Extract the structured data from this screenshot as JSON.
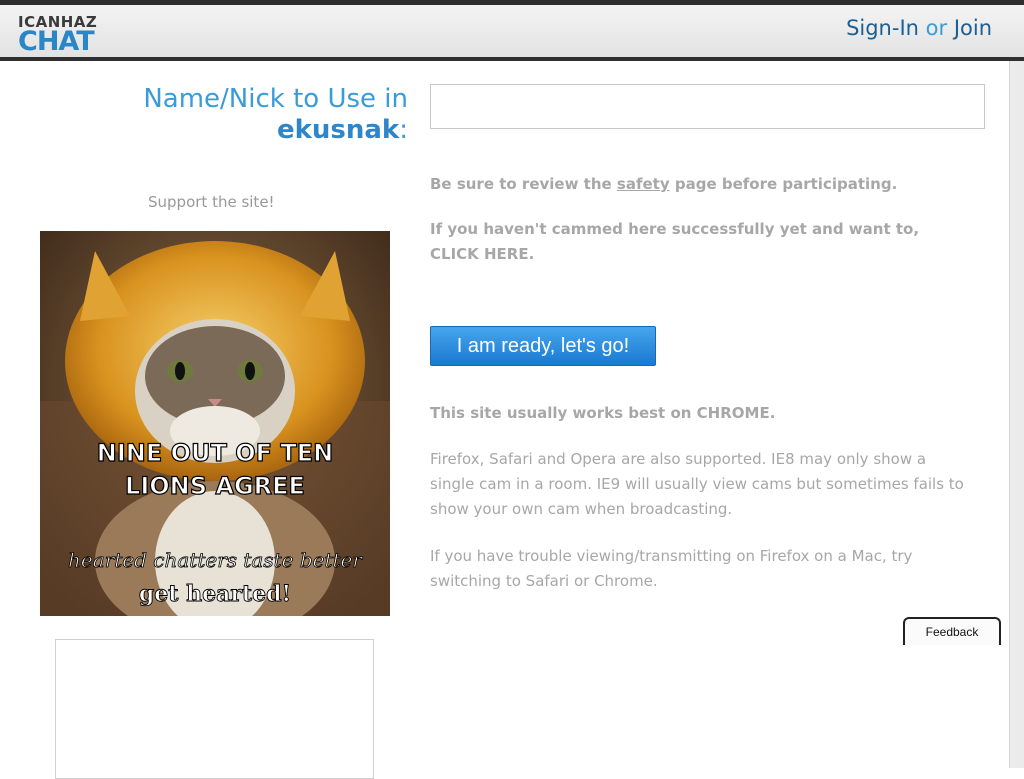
{
  "header": {
    "logo_top": "ICANHAZ",
    "logo_bottom": "CHAT",
    "signin": "Sign-In",
    "or": "or",
    "join": "Join"
  },
  "form": {
    "label_prefix": "Name/Nick to Use in",
    "label_user": "ekusnak",
    "label_suffix": ":",
    "input_value": ""
  },
  "sidebar": {
    "support": "Support the site!",
    "ad_line1": "NINE OUT OF TEN",
    "ad_line2": "LIONS AGREE",
    "ad_line3": "hearted chatters taste better",
    "ad_line4": "get hearted!"
  },
  "main": {
    "safety_pre": "Be sure to review the ",
    "safety_link": "safety",
    "safety_post": " page before participating.",
    "cam_text": "If you haven't cammed here successfully yet and want to,",
    "click_here": "CLICK HERE.",
    "go_button": "I am ready, let's go!",
    "chrome": "This site usually works best on CHROME.",
    "browsers_1": "Firefox, Safari and Opera are also supported. IE8 may only show a",
    "browsers_2": "single cam in a room. IE9 will usually view cams but sometimes fails to",
    "browsers_3": "show your own cam when broadcasting.",
    "mac_1": "If you have trouble viewing/transmitting on Firefox on a Mac, try",
    "mac_2": "switching to Safari or Chrome."
  },
  "feedback": "Feedback"
}
